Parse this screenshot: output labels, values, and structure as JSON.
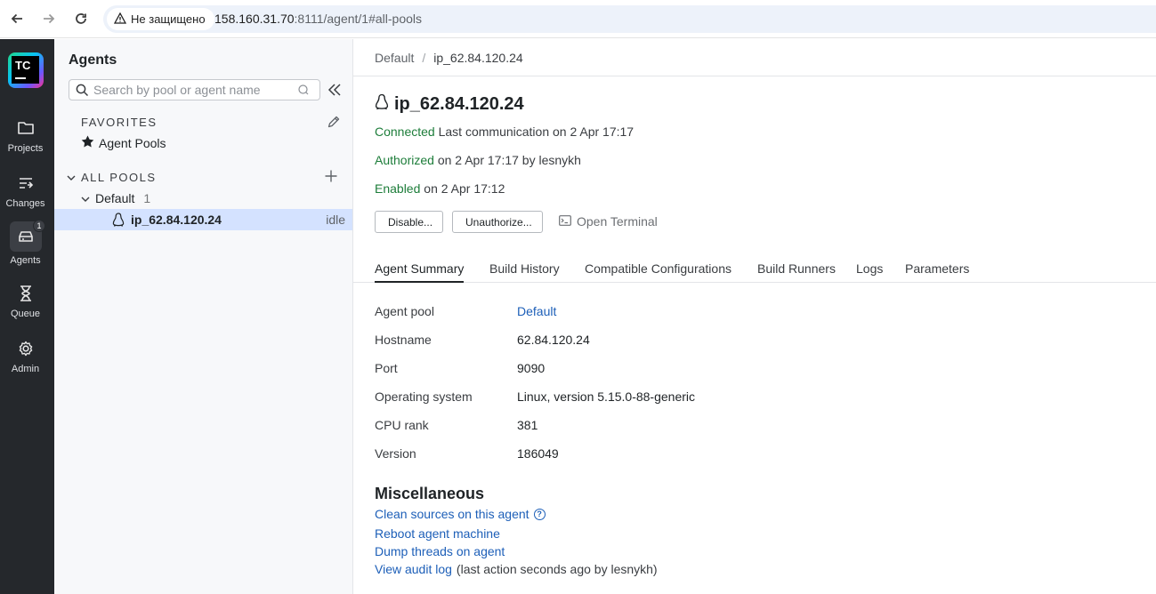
{
  "browser": {
    "security_label": "Не защищено",
    "url_host": "158.160.31.70",
    "url_path": ":8111/agent/1#all-pools"
  },
  "rail": {
    "logo_text": "TC",
    "items": [
      {
        "label": "Projects",
        "icon": "folder-icon"
      },
      {
        "label": "Changes",
        "icon": "changes-icon"
      },
      {
        "label": "Agents",
        "icon": "agents-icon",
        "badge": "1",
        "active": true
      },
      {
        "label": "Queue",
        "icon": "hourglass-icon"
      },
      {
        "label": "Admin",
        "icon": "gear-icon"
      }
    ]
  },
  "sidebar": {
    "title": "Agents",
    "search_placeholder": "Search by pool or agent name",
    "favorites_heading": "FAVORITES",
    "favorites_item": "Agent Pools",
    "all_pools_heading": "ALL POOLS",
    "pool_name": "Default",
    "pool_count": "1",
    "agent_name": "ip_62.84.120.24",
    "agent_status": "idle"
  },
  "main": {
    "breadcrumb_root": "Default",
    "breadcrumb_sep": "/",
    "breadcrumb_current": "ip_62.84.120.24",
    "agent_title": "ip_62.84.120.24",
    "connected": "Connected",
    "connected_rest": "Last communication on 2 Apr 17:17",
    "authorized": "Authorized",
    "authorized_rest": "on 2 Apr 17:17 by lesnykh",
    "enabled": "Enabled",
    "enabled_rest": "on 2 Apr 17:12",
    "disable_button": "Disable...",
    "unauthorize_button": "Unauthorize...",
    "terminal_button": "Open Terminal",
    "tabs": [
      "Agent Summary",
      "Build History",
      "Compatible Configurations",
      "Build Runners",
      "Logs",
      "Parameters"
    ],
    "details": [
      {
        "key": "Agent pool",
        "value": "Default"
      },
      {
        "key": "Hostname",
        "value": "62.84.120.24"
      },
      {
        "key": "Port",
        "value": "9090"
      },
      {
        "key": "Operating system",
        "value": "Linux, version 5.15.0-88-generic"
      },
      {
        "key": "CPU rank",
        "value": "381"
      },
      {
        "key": "Version",
        "value": "186049"
      }
    ],
    "misc_title": "Miscellaneous",
    "misc_clean": "Clean sources on this agent",
    "misc_reboot": "Reboot agent machine",
    "misc_dump": "Dump threads on agent",
    "misc_audit": "View audit log",
    "misc_audit_note": "(last action seconds ago by lesnykh)"
  },
  "colors": {
    "rail_bg": "#25282c",
    "sidebar_bg": "#f7f8fa",
    "selected_row": "#d4e2ff",
    "status_green": "#1d7d3a",
    "link_blue": "#1d5fb8"
  }
}
